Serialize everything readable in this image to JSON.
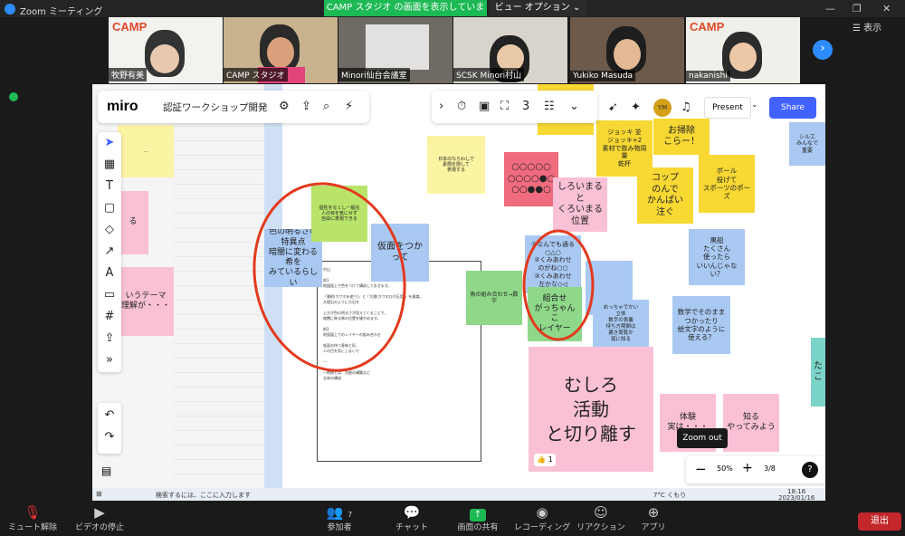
{
  "window": {
    "title": "Zoom ミーティング",
    "share_banner": "CAMP スタジオ の画面を表示しています",
    "view_options": "ビュー オプション ⌄",
    "display_label": "表示"
  },
  "participants": [
    {
      "name": "牧野有美",
      "has_logo": true,
      "logo": "CAMP"
    },
    {
      "name": "CAMP スタジオ",
      "has_logo": false
    },
    {
      "name": "Minori仙台会議室",
      "has_logo": false
    },
    {
      "name": "SCSK Minori村山",
      "has_logo": false
    },
    {
      "name": "Yukiko Masuda",
      "has_logo": false
    },
    {
      "name": "nakanishi",
      "has_logo": true,
      "logo": "CAMP"
    }
  ],
  "miro": {
    "logo": "miro",
    "board_name": "認証ワークショップ開発",
    "present_label": "Present",
    "share_label": "Share",
    "avatar_initials": "YM",
    "zoom_level": "50%",
    "zoom_tooltip": "Zoom out",
    "page_counter": "3/8"
  },
  "stickies": {
    "s_purple_light": "色の明るさの\n特異点\n暗闇に変わる希を\nみているらしい",
    "s_blue_kamen": "仮面をつかって",
    "s_green_small": "個性をなくし一般化\n人の目を気にせず\n自由に表現できる",
    "s_yellow_top": "日本のならわしで\n素顔を隠して\n表現する",
    "s_red_circles": "○○○○○\n○○○○●○\n○○●●○",
    "s_pink_shiro": "しろいまると\nくろいまる\n位置",
    "s_green_mid": "魚の組み合わせ→数字",
    "s_blue_nanka": "①なんでも通る\n○△○\n②くみあわせ\nのがね○○\n③くみあわせ\n左かな◇◁",
    "s_green_kumiawase": "組合せ\nがっちゃんこ\nレイヤー",
    "s_blue_kitai": "めっちゃでかい\n立体\n数字の表裏\n持ち方期間は\n書き周覧か\n窯に知る",
    "s_pink_mushiro": "むしろ\n活動\nと切り離す",
    "s_yellow_jokki": "ジョッキ 並\nジョッキ+2\n素材で飲み物周量\n乾杯",
    "s_yellow_osouji": "お掃除\nこらー！",
    "s_yellow_koppu": "コップ\nのんで\nかんぱい\n注ぐ",
    "s_yellow_ball": "ボール\n投げて\nスポーツのポーズ",
    "s_blue_heiko": "黒船\nたくさん\n使ったら\nいいんじゃない？",
    "s_blue_sugaku": "数学でそのまま\nつかったり\n絵文字のように\n使える？",
    "s_pink_taiken": "体験\n実は・・・",
    "s_pink_shiru": "知る\nやってみよう",
    "s_pink_left": "いうテーマ\n理解が・・・",
    "s_blue_right": "シルエ\nみんなで\n重要",
    "s_teal_right": "た\nこ",
    "like_count": "1"
  },
  "doc_text": "村山\n\n前1\n地図面上で色をつけて構成しておきます。\n\n「美術(カサホを使う)」と「大理(カサのひげ石用)」を意識。\n大理石のように大石を\n\n上方が色の明るさが見えてくることで、\n暗闇に映る希の位置を確かめます。\n\n前2\n地面図上でのレイヤーの組み合わせ\n\n仮面の持つ意味と形、\n人の目を気にしないで\n\n---\n\n一時期とは、台座の構築など\n全体の構成",
  "taskbar": {
    "search": "検索するには、ここに入力します",
    "time": "18:16",
    "date": "2023/01/16",
    "weather": "7°C くもり"
  },
  "bottom": {
    "mute": "ミュート解除",
    "video": "ビデオの停止",
    "participants": "参加者",
    "participant_count": "7",
    "chat": "チャット",
    "share": "画面の共有",
    "record": "レコーディング",
    "reaction": "リアクション",
    "apps": "アプリ",
    "exit": "退出"
  }
}
